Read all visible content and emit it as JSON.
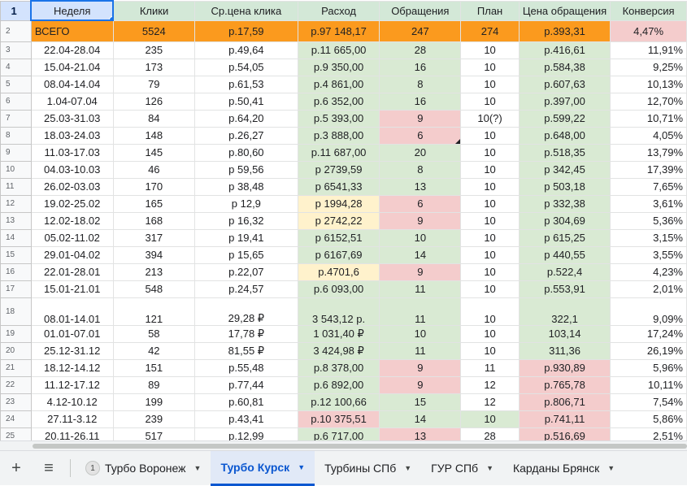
{
  "headers": [
    "Неделя",
    "Клики",
    "Ср.цена клика",
    "Расход",
    "Обращения",
    "План",
    "Цена обращения",
    "Конверсия"
  ],
  "header_row_number": "1",
  "total": {
    "row_number": "2",
    "cells": [
      "ВСЕГО",
      "5524",
      "р.17,59",
      "р.97 148,17",
      "247",
      "274",
      "р.393,31",
      "4,47%"
    ]
  },
  "rows": [
    {
      "n": "3",
      "cells": [
        "22.04-28.04",
        "235",
        "р.49,64",
        "р.11 665,00",
        "28",
        "10",
        "р.416,61",
        "11,91%"
      ]
    },
    {
      "n": "4",
      "cells": [
        "15.04-21.04",
        "173",
        "р.54,05",
        "р.9 350,00",
        "16",
        "10",
        "р.584,38",
        "9,25%"
      ]
    },
    {
      "n": "5",
      "cells": [
        "08.04-14.04",
        "79",
        "р.61,53",
        "р.4 861,00",
        "8",
        "10",
        "р.607,63",
        "10,13%"
      ]
    },
    {
      "n": "6",
      "cells": [
        "1.04-07.04",
        "126",
        "р.50,41",
        "р.6 352,00",
        "16",
        "10",
        "р.397,00",
        "12,70%"
      ]
    },
    {
      "n": "7",
      "cells": [
        "25.03-31.03",
        "84",
        "р.64,20",
        "р.5 393,00",
        "9",
        "10(?)",
        "р.599,22",
        "10,71%"
      ]
    },
    {
      "n": "8",
      "cells": [
        "18.03-24.03",
        "148",
        "р.26,27",
        "р.3 888,00",
        "6",
        "10",
        "р.648,00",
        "4,05%"
      ]
    },
    {
      "n": "9",
      "cells": [
        "11.03-17.03",
        "145",
        "р.80,60",
        "р.11 687,00",
        "20",
        "10",
        "р.518,35",
        "13,79%"
      ]
    },
    {
      "n": "10",
      "cells": [
        "04.03-10.03",
        "46",
        "р 59,56",
        "р 2739,59",
        "8",
        "10",
        "р 342,45",
        "17,39%"
      ]
    },
    {
      "n": "11",
      "cells": [
        "26.02-03.03",
        "170",
        "р 38,48",
        "р 6541,33",
        "13",
        "10",
        "р 503,18",
        "7,65%"
      ]
    },
    {
      "n": "12",
      "cells": [
        "19.02-25.02",
        "165",
        "р 12,9",
        "р 1994,28",
        "6",
        "10",
        "р 332,38",
        "3,61%"
      ]
    },
    {
      "n": "13",
      "cells": [
        "12.02-18.02",
        "168",
        "р 16,32",
        "р 2742,22",
        "9",
        "10",
        "р 304,69",
        "5,36%"
      ]
    },
    {
      "n": "14",
      "cells": [
        "05.02-11.02",
        "317",
        "р 19,41",
        "р 6152,51",
        "10",
        "10",
        "р 615,25",
        "3,15%"
      ]
    },
    {
      "n": "15",
      "cells": [
        "29.01-04.02",
        "394",
        "р 15,65",
        "р 6167,69",
        "14",
        "10",
        "р 440,55",
        "3,55%"
      ]
    },
    {
      "n": "16",
      "cells": [
        "22.01-28.01",
        "213",
        "р.22,07",
        "р.4701,6",
        "9",
        "10",
        "р.522,4",
        "4,23%"
      ]
    },
    {
      "n": "17",
      "cells": [
        "15.01-21.01",
        "548",
        "р.24,57",
        "р.6 093,00",
        "11",
        "10",
        "р.553,91",
        "2,01%"
      ]
    },
    {
      "n": "18",
      "cells": [
        "08.01-14.01",
        "121",
        "29,28 ₽",
        "3 543,12  р.",
        "11",
        "10",
        "322,1",
        "9,09%"
      ]
    },
    {
      "n": "19",
      "cells": [
        "01.01-07.01",
        "58",
        "17,78 ₽",
        "1 031,40 ₽",
        "10",
        "10",
        "103,14",
        "17,24%"
      ]
    },
    {
      "n": "20",
      "cells": [
        "25.12-31.12",
        "42",
        "81,55 ₽",
        "3 424,98 ₽",
        "11",
        "10",
        "311,36",
        "26,19%"
      ]
    },
    {
      "n": "21",
      "cells": [
        "18.12-14.12",
        "151",
        "р.55,48",
        "р.8 378,00",
        "9",
        "11",
        "р.930,89",
        "5,96%"
      ]
    },
    {
      "n": "22",
      "cells": [
        "11.12-17.12",
        "89",
        "р.77,44",
        "р.6 892,00",
        "9",
        "12",
        "р.765,78",
        "10,11%"
      ]
    },
    {
      "n": "23",
      "cells": [
        "4.12-10.12",
        "199",
        "р.60,81",
        "р.12 100,66",
        "15",
        "12",
        "р.806,71",
        "7,54%"
      ]
    },
    {
      "n": "24",
      "cells": [
        "27.11-3.12",
        "239",
        "р.43,41",
        "р.10 375,51",
        "14",
        "10",
        "р.741,11",
        "5,86%"
      ]
    },
    {
      "n": "25",
      "cells": [
        "20.11-26.11",
        "517",
        "р.12,99",
        "р.6 717,00",
        "13",
        "28",
        "р.516,69",
        "2,51%"
      ]
    }
  ],
  "tabs": [
    {
      "label": "Турбо Воронеж",
      "badge": "1",
      "active": false
    },
    {
      "label": "Турбо Курск",
      "active": true
    },
    {
      "label": "Турбины СПб",
      "active": false
    },
    {
      "label": "ГУР СПб",
      "active": false
    },
    {
      "label": "Карданы Брянск",
      "active": false
    }
  ],
  "colors": {
    "header_bg": "#d3e8d7",
    "total_bg": "#fb9a1e",
    "green": "#d9ead3",
    "pink": "#f4cccc",
    "yellow": "#fff2cc",
    "active_tab": "#0b57d0"
  },
  "icons": {
    "add_sheet": "plus-icon",
    "all_sheets": "menu-icon",
    "tab_menu": "caret-down-icon"
  }
}
